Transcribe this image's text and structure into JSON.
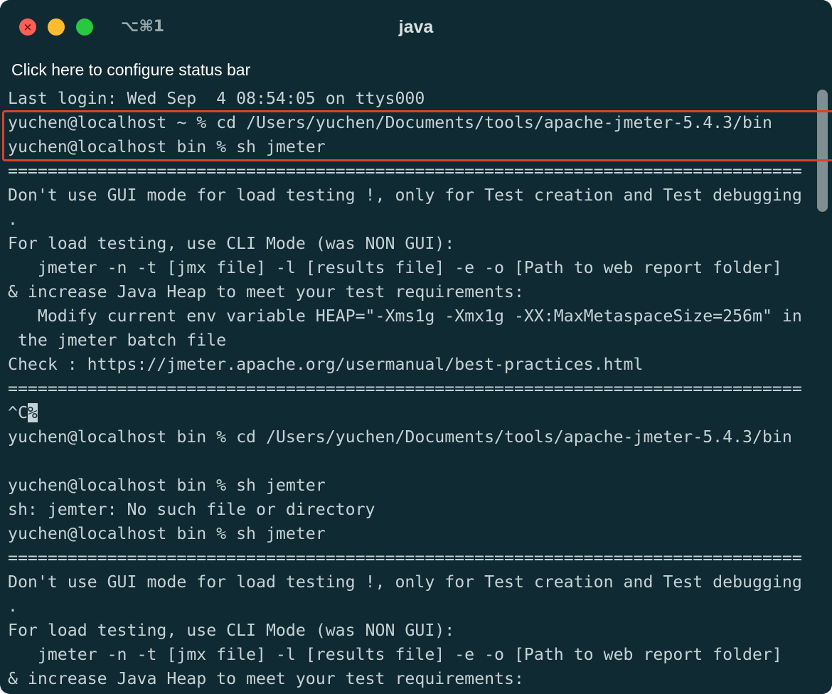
{
  "window": {
    "title": "java",
    "shortcut": "⌥⌘1",
    "close_icon": "close-icon",
    "minimize_icon": "minimize-icon",
    "zoom_icon": "zoom-icon"
  },
  "statusbar": {
    "text": "Click here to configure status bar"
  },
  "terminal": {
    "lines": [
      "Last login: Wed Sep  4 08:54:05 on ttys000",
      "yuchen@localhost ~ % cd /Users/yuchen/Documents/tools/apache-jmeter-5.4.3/bin",
      "yuchen@localhost bin % sh jmeter",
      "================================================================================",
      "Don't use GUI mode for load testing !, only for Test creation and Test debugging",
      ".",
      "For load testing, use CLI Mode (was NON GUI):",
      "   jmeter -n -t [jmx file] -l [results file] -e -o [Path to web report folder]",
      "& increase Java Heap to meet your test requirements:",
      "   Modify current env variable HEAP=\"-Xms1g -Xmx1g -XX:MaxMetaspaceSize=256m\" in",
      " the jmeter batch file",
      "Check : https://jmeter.apache.org/usermanual/best-practices.html",
      "================================================================================",
      "^C",
      "yuchen@localhost bin % cd /Users/yuchen/Documents/tools/apache-jmeter-5.4.3/bin",
      "",
      "yuchen@localhost bin % sh jemter",
      "sh: jemter: No such file or directory",
      "yuchen@localhost bin % sh jmeter",
      "================================================================================",
      "Don't use GUI mode for load testing !, only for Test creation and Test debugging",
      ".",
      "For load testing, use CLI Mode (was NON GUI):",
      "   jmeter -n -t [jmx file] -l [results file] -e -o [Path to web report folder]",
      "& increase Java Heap to meet your test requirements:"
    ],
    "cursor_char": "%"
  },
  "colors": {
    "background": "#102a33",
    "text": "#c6d2d6",
    "highlight_box": "#d9432b"
  }
}
